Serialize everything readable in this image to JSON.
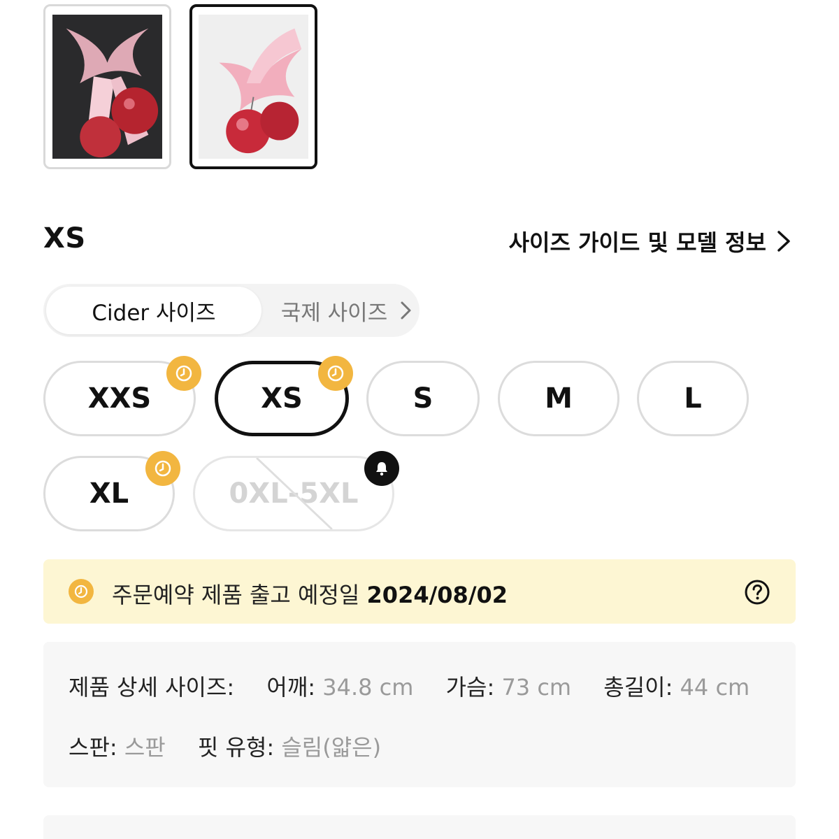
{
  "selected_size_heading": "XS",
  "size_guide_link": "사이즈 가이드 및 모델 정보",
  "size_system": {
    "active_label": "Cider 사이즈",
    "inactive_label": "국제 사이즈"
  },
  "sizes": [
    {
      "label": "XXS",
      "badge": "clock-icon"
    },
    {
      "label": "XS",
      "badge": "clock-icon",
      "selected": true
    },
    {
      "label": "S"
    },
    {
      "label": "M"
    },
    {
      "label": "L"
    },
    {
      "label": "XL",
      "badge": "clock-icon"
    },
    {
      "label": "0XL-5XL",
      "badge": "bell-icon",
      "disabled": true
    }
  ],
  "preorder_banner": {
    "text": "주문예약 제품 출고 예정일 ",
    "date": "2024/08/02"
  },
  "details": {
    "heading": "제품 상세 사이즈:",
    "shoulder_label": "어깨:",
    "shoulder_value": " 34.8 cm",
    "chest_label": "가슴:",
    "chest_value": " 73 cm",
    "length_label": "총길이:",
    "length_value": " 44 cm",
    "stretch_label": "스판:",
    "stretch_value": " 스판",
    "fit_label": "핏 유형:",
    "fit_value": " 슬림(얇은)"
  },
  "colors": {
    "accent_clock": "#f2b640",
    "banner_bg": "#fdf6d3",
    "selected_border": "#111111"
  }
}
